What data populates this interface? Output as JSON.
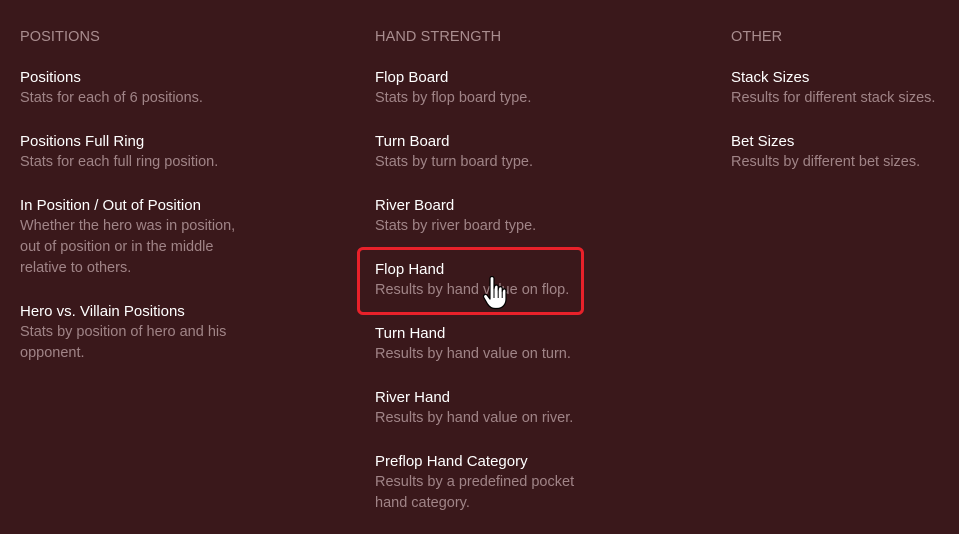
{
  "colors": {
    "background": "#3a181b",
    "heading": "#a98d8f",
    "title": "#ffffff",
    "description": "#a08487",
    "highlight": "#e8212a"
  },
  "sections": [
    {
      "heading": "POSITIONS",
      "items": [
        {
          "title": "Positions",
          "description": "Stats for each of 6 positions."
        },
        {
          "title": "Positions Full Ring",
          "description": "Stats for each full ring position."
        },
        {
          "title": "In Position / Out of Position",
          "description": "Whether the hero was in position, out of position or in the middle relative to others."
        },
        {
          "title": "Hero vs. Villain Positions",
          "description": "Stats by position of hero and his opponent."
        }
      ]
    },
    {
      "heading": "HAND STRENGTH",
      "items": [
        {
          "title": "Flop Board",
          "description": "Stats by flop board type."
        },
        {
          "title": "Turn Board",
          "description": "Stats by turn board type."
        },
        {
          "title": "River Board",
          "description": "Stats by river board type."
        },
        {
          "title": "Flop Hand",
          "description": "Results by hand value on flop."
        },
        {
          "title": "Turn Hand",
          "description": "Results by hand value on turn."
        },
        {
          "title": "River Hand",
          "description": "Results by hand value on river."
        },
        {
          "title": "Preflop Hand Category",
          "description": "Results by a predefined pocket hand category."
        }
      ]
    },
    {
      "heading": "OTHER",
      "items": [
        {
          "title": "Stack Sizes",
          "description": "Results for different stack sizes."
        },
        {
          "title": "Bet Sizes",
          "description": "Results by different bet sizes."
        }
      ]
    }
  ],
  "highlighted_item": "Flop Hand",
  "cursor_icon": "hand-pointer-icon"
}
